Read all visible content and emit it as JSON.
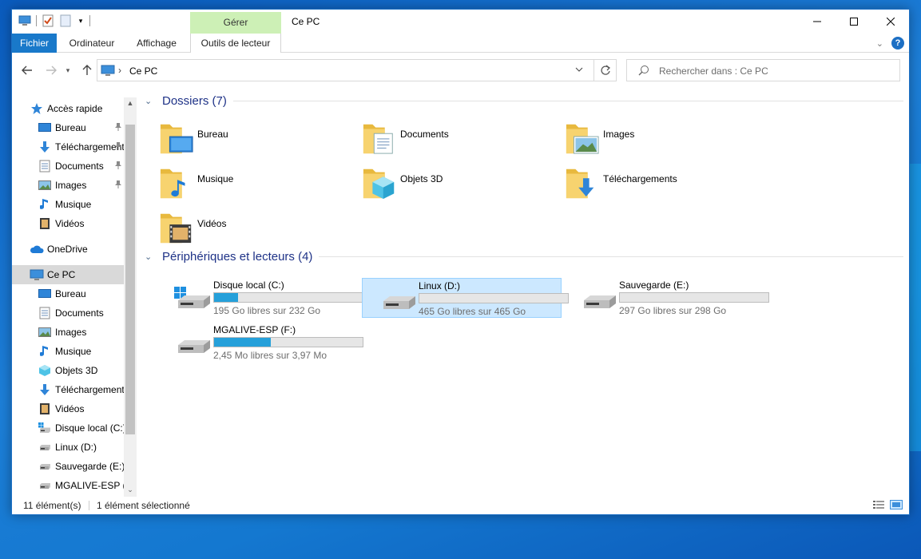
{
  "window": {
    "title": "Ce PC",
    "manage_tab": "Gérer"
  },
  "ribbon": {
    "tabs": [
      "Fichier",
      "Ordinateur",
      "Affichage",
      "Outils de lecteur"
    ]
  },
  "address": {
    "path": "Ce PC",
    "search_placeholder": "Rechercher dans : Ce PC"
  },
  "sidebar": {
    "quick_access": "Accès rapide",
    "quick_items": [
      {
        "label": "Bureau",
        "icon": "desktop-icon"
      },
      {
        "label": "Téléchargements",
        "icon": "download-icon"
      },
      {
        "label": "Documents",
        "icon": "document-icon"
      },
      {
        "label": "Images",
        "icon": "image-icon"
      },
      {
        "label": "Musique",
        "icon": "music-icon"
      },
      {
        "label": "Vidéos",
        "icon": "video-icon"
      }
    ],
    "onedrive": "OneDrive",
    "this_pc": "Ce PC",
    "pc_items": [
      {
        "label": "Bureau"
      },
      {
        "label": "Documents"
      },
      {
        "label": "Images"
      },
      {
        "label": "Musique"
      },
      {
        "label": "Objets 3D"
      },
      {
        "label": "Téléchargements"
      },
      {
        "label": "Vidéos"
      },
      {
        "label": "Disque local (C:)"
      },
      {
        "label": "Linux (D:)"
      },
      {
        "label": "Sauvegarde (E:)"
      },
      {
        "label": "MGALIVE-ESP (F:)"
      }
    ]
  },
  "content": {
    "folders_header": "Dossiers (7)",
    "folders": [
      {
        "name": "Bureau",
        "overlay": "desktop"
      },
      {
        "name": "Documents",
        "overlay": "document"
      },
      {
        "name": "Images",
        "overlay": "image"
      },
      {
        "name": "Musique",
        "overlay": "music"
      },
      {
        "name": "Objets 3D",
        "overlay": "cube"
      },
      {
        "name": "Téléchargements",
        "overlay": "download"
      },
      {
        "name": "Vidéos",
        "overlay": "video"
      }
    ],
    "devices_header": "Périphériques et lecteurs (4)",
    "drives": [
      {
        "name": "Disque local (C:)",
        "free": "195 Go libres sur 232 Go",
        "used_fraction": 0.16,
        "windows_logo": true,
        "selected": false
      },
      {
        "name": "Linux (D:)",
        "free": "465 Go libres sur 465 Go",
        "used_fraction": 0.0,
        "windows_logo": false,
        "selected": true
      },
      {
        "name": "Sauvegarde (E:)",
        "free": "297 Go libres sur 298 Go",
        "used_fraction": 0.0,
        "windows_logo": false,
        "selected": false
      },
      {
        "name": "MGALIVE-ESP (F:)",
        "free": "2,45 Mo libres sur 3,97 Mo",
        "used_fraction": 0.38,
        "windows_logo": false,
        "selected": false
      }
    ]
  },
  "status": {
    "count": "11 élément(s)",
    "selection": "1 élément sélectionné"
  },
  "colors": {
    "accent": "#1979ca",
    "manage": "#cdf0b6",
    "drive_fill": "#26a0da",
    "selection": "#cce8ff"
  }
}
